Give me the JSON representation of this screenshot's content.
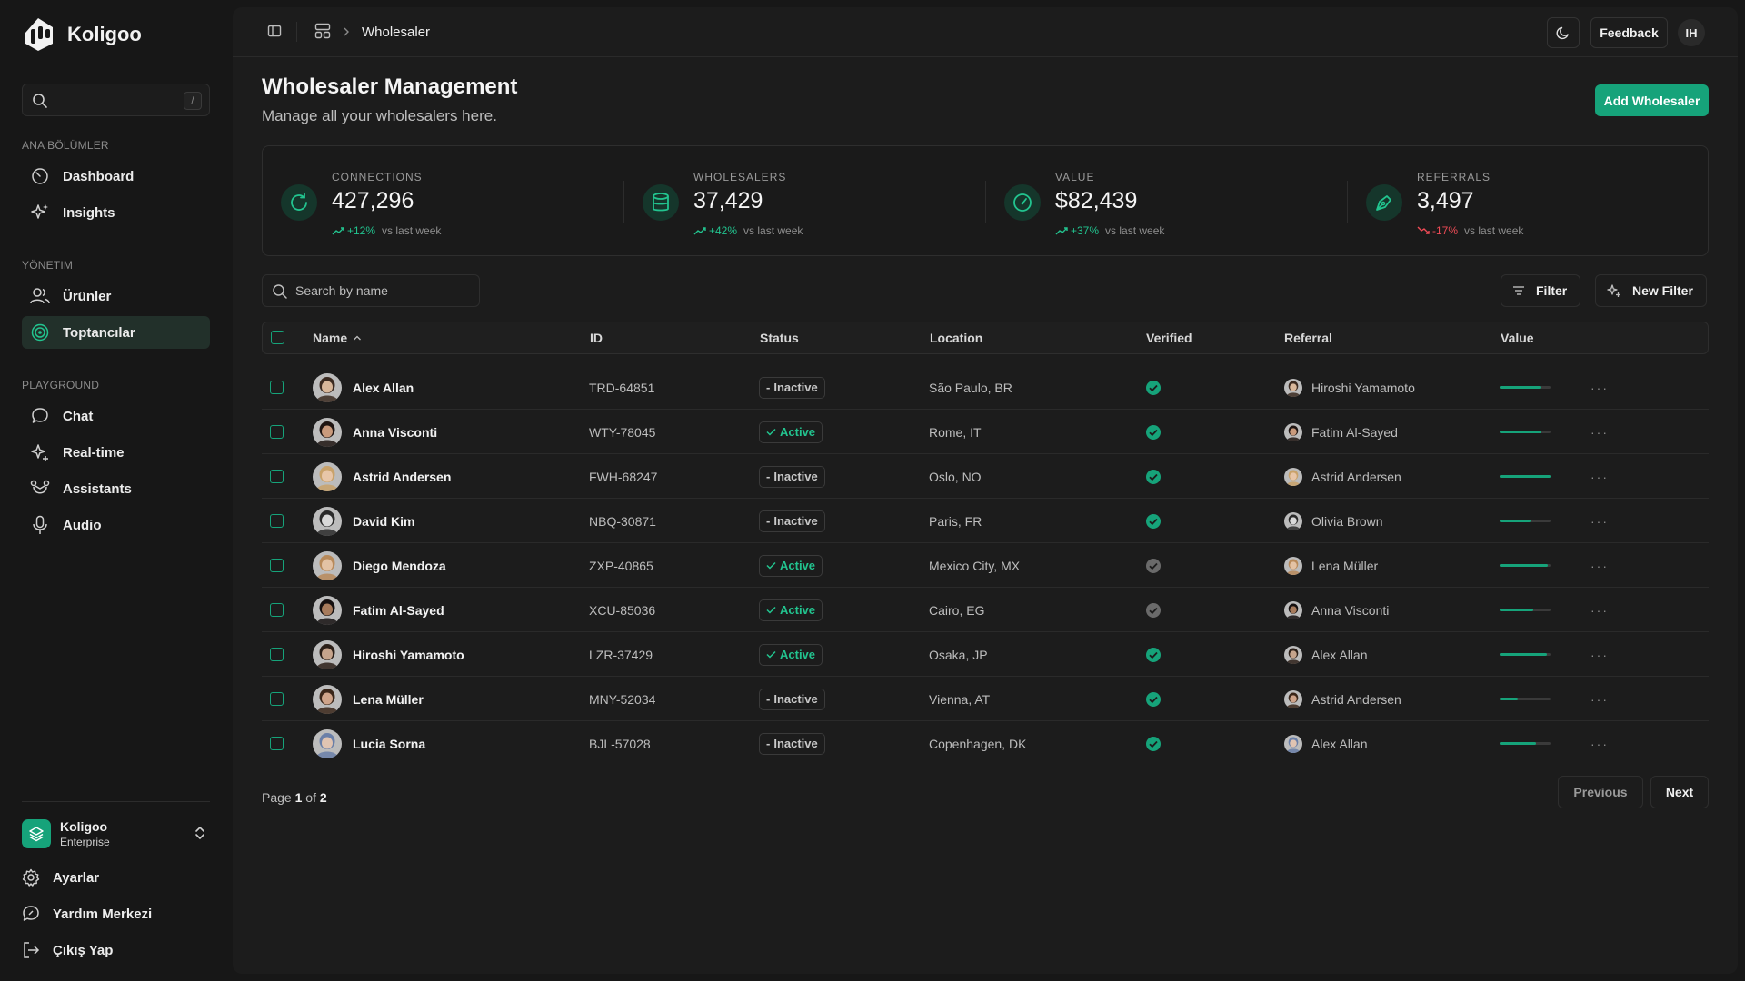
{
  "sidebar": {
    "brand": "Koligoo",
    "search_shortcut": "/",
    "sections": [
      {
        "label": "ANA BÖLÜMLER",
        "items": [
          {
            "label": "Dashboard",
            "icon": "gauge-icon"
          },
          {
            "label": "Insights",
            "icon": "sparkles-icon"
          }
        ]
      },
      {
        "label": "YÖNETIM",
        "items": [
          {
            "label": "Ürünler",
            "icon": "users-icon"
          },
          {
            "label": "Toptancılar",
            "icon": "target-icon",
            "active": true
          }
        ]
      },
      {
        "label": "PLAYGROUND",
        "items": [
          {
            "label": "Chat",
            "icon": "chat-icon"
          },
          {
            "label": "Real-time",
            "icon": "sparkle-icon"
          },
          {
            "label": "Assistants",
            "icon": "bot-icon"
          },
          {
            "label": "Audio",
            "icon": "mic-icon"
          }
        ]
      }
    ],
    "org": {
      "name": "Koligoo",
      "plan": "Enterprise"
    },
    "footer": [
      {
        "label": "Ayarlar",
        "icon": "gear-icon"
      },
      {
        "label": "Yardım Merkezi",
        "icon": "help-chat-icon"
      },
      {
        "label": "Çıkış Yap",
        "icon": "logout-icon"
      }
    ]
  },
  "topbar": {
    "breadcrumb_current": "Wholesaler",
    "feedback_label": "Feedback",
    "user_initials": "IH"
  },
  "header": {
    "title": "Wholesaler Management",
    "subtitle": "Manage all your wholesalers here.",
    "add_button": "Add Wholesaler"
  },
  "stats": [
    {
      "label": "CONNECTIONS",
      "value": "427,296",
      "change": "+12%",
      "direction": "up",
      "vs": "vs last week",
      "icon": "refresh-icon"
    },
    {
      "label": "WHOLESALERS",
      "value": "37,429",
      "change": "+42%",
      "direction": "up",
      "vs": "vs last week",
      "icon": "database-icon"
    },
    {
      "label": "VALUE",
      "value": "$82,439",
      "change": "+37%",
      "direction": "up",
      "vs": "vs last week",
      "icon": "speedometer-icon"
    },
    {
      "label": "REFERRALS",
      "value": "3,497",
      "change": "-17%",
      "direction": "down",
      "vs": "vs last week",
      "icon": "pen-tool-icon"
    }
  ],
  "toolbar": {
    "search_placeholder": "Search by name",
    "filter_label": "Filter",
    "new_filter_label": "New Filter"
  },
  "table": {
    "columns": [
      "Name",
      "ID",
      "Status",
      "Location",
      "Verified",
      "Referral",
      "Value"
    ],
    "rows": [
      {
        "name": "Alex Allan",
        "id": "TRD-64851",
        "status": "Inactive",
        "location": "São Paulo, BR",
        "verified": true,
        "referral": "Hiroshi Yamamoto",
        "value": 0.8,
        "skin": "#d8b79a",
        "hair": "#3b2a20"
      },
      {
        "name": "Anna Visconti",
        "id": "WTY-78045",
        "status": "Active",
        "location": "Rome, IT",
        "verified": true,
        "referral": "Fatim Al-Sayed",
        "value": 0.82,
        "skin": "#c99a7c",
        "hair": "#1f1512"
      },
      {
        "name": "Astrid Andersen",
        "id": "FWH-68247",
        "status": "Inactive",
        "location": "Oslo, NO",
        "verified": true,
        "referral": "Astrid Andersen",
        "value": 1.0,
        "skin": "#e8c6a8",
        "hair": "#c9a26a"
      },
      {
        "name": "David Kim",
        "id": "NBQ-30871",
        "status": "Inactive",
        "location": "Paris, FR",
        "verified": true,
        "referral": "Olivia Brown",
        "value": 0.6,
        "skin": "#d9d9d9",
        "hair": "#2a2a2a"
      },
      {
        "name": "Diego Mendoza",
        "id": "ZXP-40865",
        "status": "Active",
        "location": "Mexico City, MX",
        "verified": false,
        "referral": "Lena Müller",
        "value": 0.95,
        "skin": "#e3c2a4",
        "hair": "#b88a5a"
      },
      {
        "name": "Fatim Al-Sayed",
        "id": "XCU-85036",
        "status": "Active",
        "location": "Cairo, EG",
        "verified": false,
        "referral": "Anna Visconti",
        "value": 0.66,
        "skin": "#a77b5c",
        "hair": "#151010"
      },
      {
        "name": "Hiroshi Yamamoto",
        "id": "LZR-37429",
        "status": "Active",
        "location": "Osaka, JP",
        "verified": true,
        "referral": "Alex Allan",
        "value": 0.92,
        "skin": "#c6a48c",
        "hair": "#2b1f18"
      },
      {
        "name": "Lena Müller",
        "id": "MNY-52034",
        "status": "Inactive",
        "location": "Vienna, AT",
        "verified": true,
        "referral": "Astrid Andersen",
        "value": 0.36,
        "skin": "#cfa48a",
        "hair": "#3a2619"
      },
      {
        "name": "Lucia Sorna",
        "id": "BJL-57028",
        "status": "Inactive",
        "location": "Copenhagen, DK",
        "verified": true,
        "referral": "Alex Allan",
        "value": 0.72,
        "skin": "#e0c4b2",
        "hair": "#6a7fa8"
      }
    ]
  },
  "pagination": {
    "page_word": "Page",
    "current": "1",
    "of_word": "of",
    "total": "2",
    "previous": "Previous",
    "next": "Next"
  },
  "colors": {
    "accent": "#16a37a",
    "positive": "#22c48f",
    "negative": "#ef4b56",
    "background": "#171717",
    "panel": "#1c1c1c"
  }
}
